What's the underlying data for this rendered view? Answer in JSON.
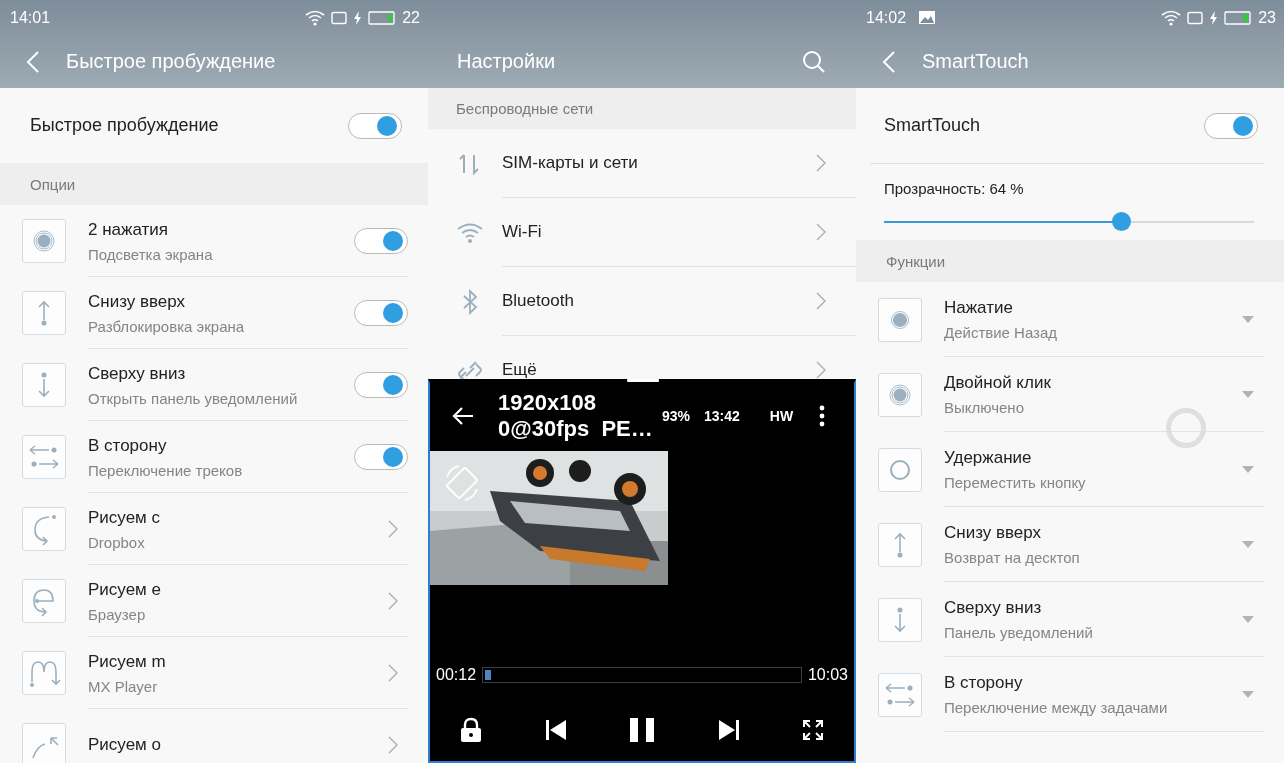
{
  "left_screen": {
    "status": {
      "time": "14:01",
      "battery": "22"
    },
    "title": "Быстрое пробуждение",
    "master": {
      "label": "Быстрое пробуждение",
      "on": true
    },
    "section": "Опции",
    "items": [
      {
        "kind": "toggle",
        "title": "2 нажатия",
        "subtitle": "Подсветка экрана",
        "on": true
      },
      {
        "kind": "toggle",
        "title": "Снизу вверх",
        "subtitle": "Разблокировка экрана",
        "on": true
      },
      {
        "kind": "toggle",
        "title": "Сверху вниз",
        "subtitle": "Открыть панель уведомлений",
        "on": true
      },
      {
        "kind": "toggle",
        "title": "В сторону",
        "subtitle": "Переключение треков",
        "on": true
      },
      {
        "kind": "link",
        "title": "Рисуем c",
        "subtitle": "Dropbox"
      },
      {
        "kind": "link",
        "title": "Рисуем e",
        "subtitle": "Браузер"
      },
      {
        "kind": "link",
        "title": "Рисуем m",
        "subtitle": "MX Player"
      },
      {
        "kind": "link",
        "title": "Рисуем o"
      }
    ]
  },
  "middle_screen": {
    "title": "Настройки",
    "section": "Беспроводные сети",
    "items": [
      {
        "title": "SIM-карты и сети"
      },
      {
        "title": "Wi-Fi"
      },
      {
        "title": "Bluetooth"
      },
      {
        "title": "Ещё"
      }
    ],
    "player": {
      "title": "1920x108\n0@30fps  PE…",
      "battery": "93%",
      "clock": "13:42",
      "decoder": "HW",
      "elapsed": "00:12",
      "duration": "10:03",
      "level": 0.02
    }
  },
  "right_screen": {
    "status": {
      "time": "14:02",
      "battery": "23"
    },
    "title": "SmartTouch",
    "master": {
      "label": "SmartTouch",
      "on": true
    },
    "slider": {
      "label": "Прозрачность: 64 %",
      "level": 0.64
    },
    "section": "Функции",
    "items": [
      {
        "title": "Нажатие",
        "subtitle": "Действие Назад"
      },
      {
        "title": "Двойной клик",
        "subtitle": "Выключено"
      },
      {
        "title": "Удержание",
        "subtitle": "Переместить кнопку"
      },
      {
        "title": "Снизу вверх",
        "subtitle": "Возврат на десктоп"
      },
      {
        "title": "Сверху вниз",
        "subtitle": "Панель уведомлений"
      },
      {
        "title": "В сторону",
        "subtitle": "Переключение между задачами"
      }
    ]
  }
}
